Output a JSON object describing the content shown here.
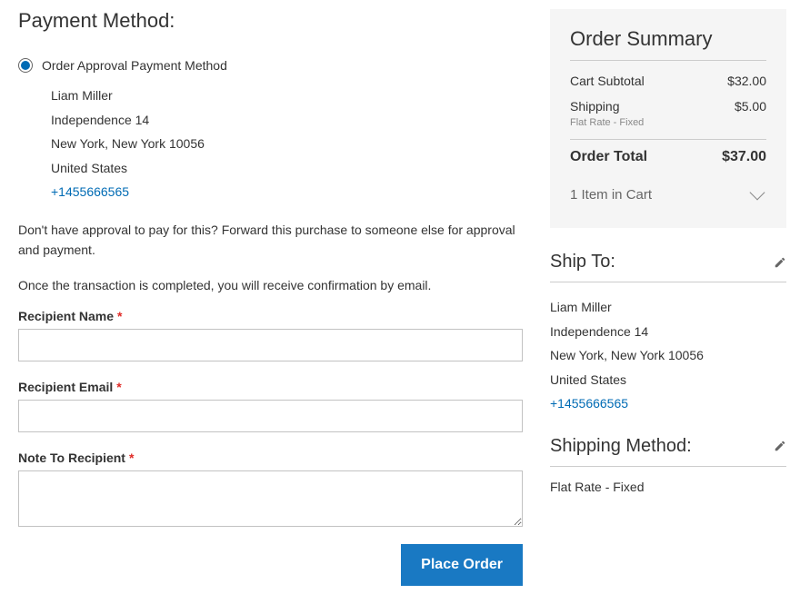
{
  "page_title": "Payment Method:",
  "payment": {
    "method_label": "Order Approval Payment Method",
    "billing_address": {
      "name": "Liam Miller",
      "street": "Independence 14",
      "city_region_postcode": "New York, New York 10056",
      "country": "United States",
      "phone": "+1455666565"
    },
    "approval_note": "Don't have approval to pay for this? Forward this purchase to someone else for approval and payment.",
    "email_note": "Once the transaction is completed, you will receive confirmation by email.",
    "fields": {
      "recipient_name_label": "Recipient Name",
      "recipient_email_label": "Recipient Email",
      "note_label": "Note To Recipient"
    },
    "place_order_label": "Place Order"
  },
  "summary": {
    "title": "Order Summary",
    "subtotal_label": "Cart Subtotal",
    "subtotal_value": "$32.00",
    "shipping_label": "Shipping",
    "shipping_sub": "Flat Rate - Fixed",
    "shipping_value": "$5.00",
    "total_label": "Order Total",
    "total_value": "$37.00",
    "cart_items_label": "1 Item in Cart"
  },
  "ship_to": {
    "title": "Ship To:",
    "name": "Liam Miller",
    "street": "Independence 14",
    "city_region_postcode": "New York, New York 10056",
    "country": "United States",
    "phone": "+1455666565"
  },
  "shipping_method": {
    "title": "Shipping Method:",
    "value": "Flat Rate - Fixed"
  }
}
